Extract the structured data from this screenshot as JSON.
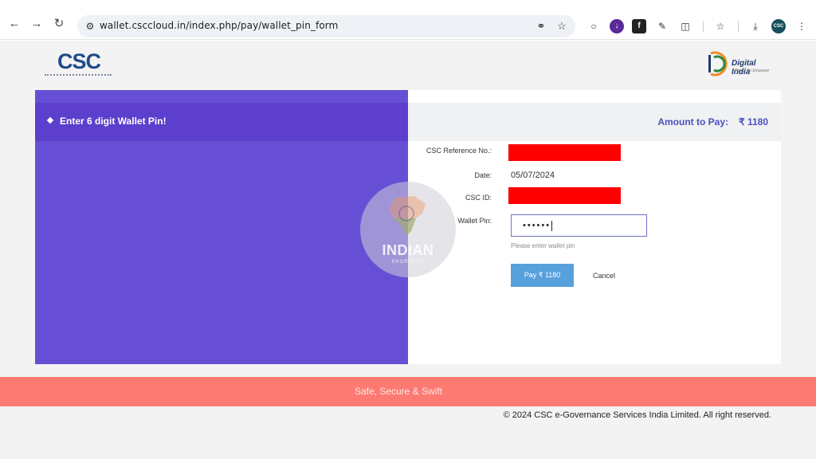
{
  "browser": {
    "url": "wallet.csccloud.in/index.php/pay/wallet_pin_form",
    "back_icon": "arrow-left-icon",
    "forward_icon": "arrow-right-icon",
    "reload_icon": "reload-icon"
  },
  "header": {
    "csc_logo_text": "CSC",
    "digital_india_text": "Digital India",
    "digital_india_tagline": "Power To Empower"
  },
  "left": {
    "instruction": "Enter 6 digit Wallet Pin!"
  },
  "right": {
    "amount_label": "Amount to Pay:",
    "amount_value": "₹  1180"
  },
  "form": {
    "ref_label": "CSC Reference No.:",
    "date_label": "Date:",
    "date_value": "05/07/2024",
    "cscid_label": "CSC ID:",
    "pin_label": "Wallet Pin:",
    "pin_value": "••••••",
    "pin_hint": "Please enter wallet pin",
    "pay_label": "Pay   ₹  1180",
    "cancel_label": "Cancel"
  },
  "watermark": {
    "title": "INDIAN",
    "subtitle": "SHORTCUT"
  },
  "footer": {
    "slogan": "Safe, Secure & Swift",
    "copyright": "© 2024 CSC e-Governance Services India Limited. All right reserved."
  },
  "colors": {
    "left_panel": "#674fd5",
    "accent": "#4a4fbf",
    "pay_button": "#57a0dc",
    "footer_band": "#fd7a72",
    "redaction": "#ff0000"
  }
}
